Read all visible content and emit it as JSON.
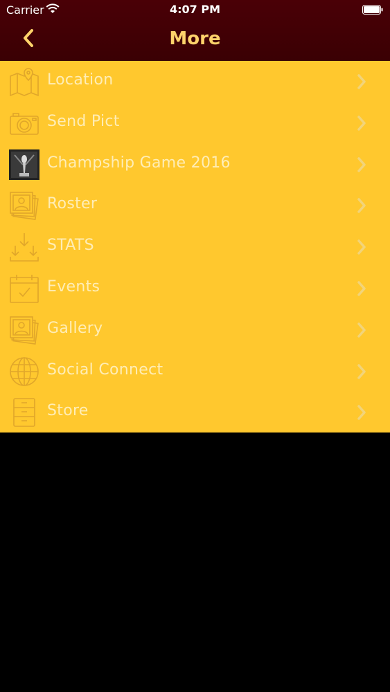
{
  "status_bar": {
    "carrier": "Carrier",
    "time": "4:07 PM"
  },
  "nav": {
    "title": "More",
    "back_icon": "chevron-left-icon"
  },
  "colors": {
    "header": "#4a0006",
    "title": "#ffd36b",
    "menu_bg": "#ffc82e",
    "label": "#fff1c2",
    "icon_stroke": "#e0a62a"
  },
  "menu": {
    "items": [
      {
        "label": "Location",
        "icon": "map-pin-icon"
      },
      {
        "label": "Send Pict",
        "icon": "camera-icon"
      },
      {
        "label": "Champship Game 2016",
        "icon": "trophy-image-icon"
      },
      {
        "label": "Roster",
        "icon": "photos-icon"
      },
      {
        "label": "STATS",
        "icon": "download-arrows-icon"
      },
      {
        "label": "Events",
        "icon": "calendar-check-icon"
      },
      {
        "label": "Gallery",
        "icon": "photos-icon"
      },
      {
        "label": "Social Connect",
        "icon": "globe-icon"
      },
      {
        "label": "Store",
        "icon": "cabinet-icon"
      }
    ]
  }
}
